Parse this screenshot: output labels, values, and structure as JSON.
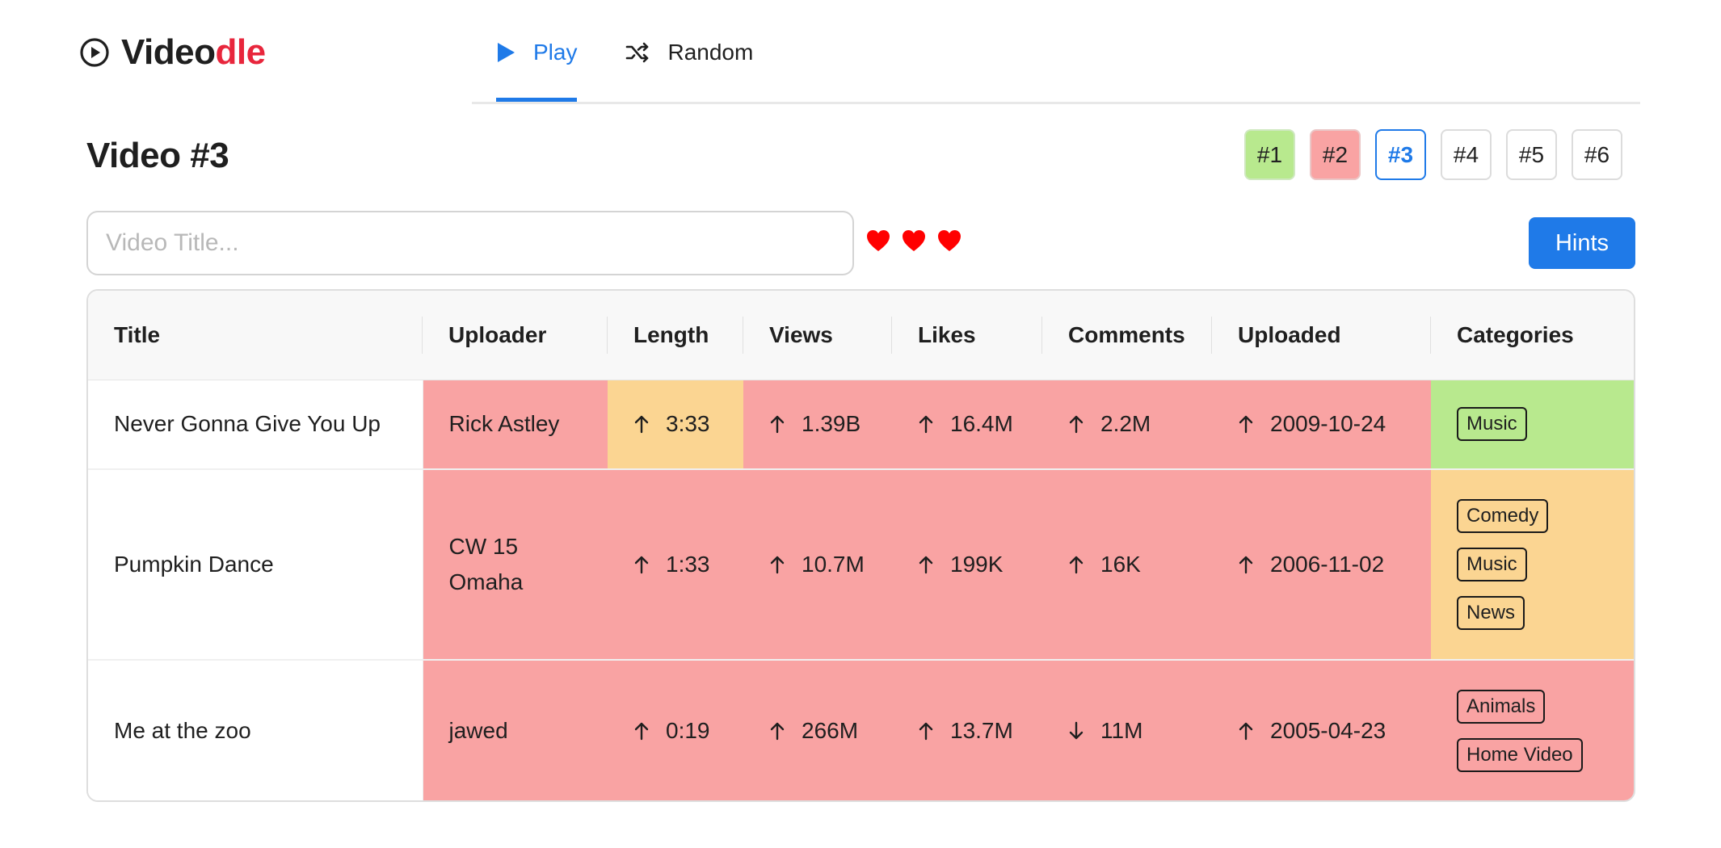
{
  "app": {
    "logo_main": "Video",
    "logo_accent": "dle",
    "accent_color": "#e8263c",
    "link_color": "#1f7ae8"
  },
  "nav": {
    "items": [
      {
        "label": "Play",
        "icon": "play-icon",
        "active": true
      },
      {
        "label": "Random",
        "icon": "shuffle-icon",
        "active": false
      }
    ]
  },
  "page": {
    "title": "Video #3",
    "video_tabs": [
      {
        "label": "#1",
        "state": "win"
      },
      {
        "label": "#2",
        "state": "lose"
      },
      {
        "label": "#3",
        "state": "current"
      },
      {
        "label": "#4",
        "state": "empty"
      },
      {
        "label": "#5",
        "state": "empty"
      },
      {
        "label": "#6",
        "state": "empty"
      }
    ]
  },
  "guess": {
    "placeholder": "Video Title...",
    "value": "",
    "hearts_remaining": 3,
    "heart_color": "#ff0000",
    "hints_label": "Hints"
  },
  "table": {
    "headers": [
      "Title",
      "Uploader",
      "Length",
      "Views",
      "Likes",
      "Comments",
      "Uploaded",
      "Categories"
    ],
    "status_colors": {
      "bad": "#f9a3a3",
      "close": "#fbd592",
      "good": "#b8e98e"
    },
    "rows": [
      {
        "title": "Never Gonna Give You Up",
        "uploader": "Rick Astley",
        "length": {
          "value": "3:33",
          "dir": "up",
          "status": "close"
        },
        "views": {
          "value": "1.39B",
          "dir": "up",
          "status": "bad"
        },
        "likes": {
          "value": "16.4M",
          "dir": "up",
          "status": "bad"
        },
        "comments": {
          "value": "2.2M",
          "dir": "up",
          "status": "bad"
        },
        "uploaded": {
          "value": "2009-10-24",
          "dir": "up",
          "status": "bad"
        },
        "categories": [
          "Music"
        ],
        "categories_status": "good"
      },
      {
        "title": "Pumpkin Dance",
        "uploader": "CW 15 Omaha",
        "length": {
          "value": "1:33",
          "dir": "up",
          "status": "bad"
        },
        "views": {
          "value": "10.7M",
          "dir": "up",
          "status": "bad"
        },
        "likes": {
          "value": "199K",
          "dir": "up",
          "status": "bad"
        },
        "comments": {
          "value": "16K",
          "dir": "up",
          "status": "bad"
        },
        "uploaded": {
          "value": "2006-11-02",
          "dir": "up",
          "status": "bad"
        },
        "categories": [
          "Comedy",
          "Music",
          "News"
        ],
        "categories_status": "close"
      },
      {
        "title": "Me at the zoo",
        "uploader": "jawed",
        "length": {
          "value": "0:19",
          "dir": "up",
          "status": "bad"
        },
        "views": {
          "value": "266M",
          "dir": "up",
          "status": "bad"
        },
        "likes": {
          "value": "13.7M",
          "dir": "up",
          "status": "bad"
        },
        "comments": {
          "value": "11M",
          "dir": "down",
          "status": "bad"
        },
        "uploaded": {
          "value": "2005-04-23",
          "dir": "up",
          "status": "bad"
        },
        "categories": [
          "Animals",
          "Home Video"
        ],
        "categories_status": "bad"
      }
    ]
  }
}
